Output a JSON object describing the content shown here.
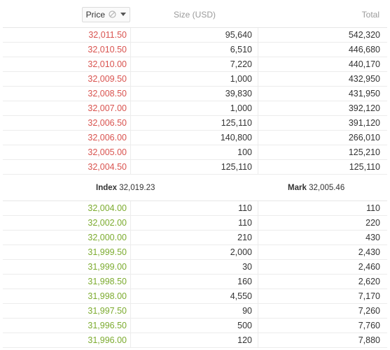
{
  "header": {
    "price_label": "Price",
    "size_label": "Size (USD)",
    "total_label": "Total"
  },
  "asks": [
    {
      "price": "32,011.50",
      "size": "95,640",
      "total": "542,320"
    },
    {
      "price": "32,010.50",
      "size": "6,510",
      "total": "446,680"
    },
    {
      "price": "32,010.00",
      "size": "7,220",
      "total": "440,170"
    },
    {
      "price": "32,009.50",
      "size": "1,000",
      "total": "432,950"
    },
    {
      "price": "32,008.50",
      "size": "39,830",
      "total": "431,950"
    },
    {
      "price": "32,007.00",
      "size": "1,000",
      "total": "392,120"
    },
    {
      "price": "32,006.50",
      "size": "125,110",
      "total": "391,120"
    },
    {
      "price": "32,006.00",
      "size": "140,800",
      "total": "266,010"
    },
    {
      "price": "32,005.00",
      "size": "100",
      "total": "125,210"
    },
    {
      "price": "32,004.50",
      "size": "125,110",
      "total": "125,110"
    }
  ],
  "mid": {
    "index_label": "Index",
    "index_value": "32,019.23",
    "mark_label": "Mark",
    "mark_value": "32,005.46"
  },
  "bids": [
    {
      "price": "32,004.00",
      "size": "110",
      "total": "110"
    },
    {
      "price": "32,002.00",
      "size": "110",
      "total": "220"
    },
    {
      "price": "32,000.00",
      "size": "210",
      "total": "430"
    },
    {
      "price": "31,999.50",
      "size": "2,000",
      "total": "2,430"
    },
    {
      "price": "31,999.00",
      "size": "30",
      "total": "2,460"
    },
    {
      "price": "31,998.50",
      "size": "160",
      "total": "2,620"
    },
    {
      "price": "31,998.00",
      "size": "4,550",
      "total": "7,170"
    },
    {
      "price": "31,997.50",
      "size": "90",
      "total": "7,260"
    },
    {
      "price": "31,996.50",
      "size": "500",
      "total": "7,760"
    },
    {
      "price": "31,996.00",
      "size": "120",
      "total": "7,880"
    }
  ],
  "icons": {
    "price_filter": "no-symbol-icon",
    "price_sort": "caret-down-icon"
  },
  "colors": {
    "ask_price": "#d9534f",
    "bid_price": "#7cab2f"
  }
}
